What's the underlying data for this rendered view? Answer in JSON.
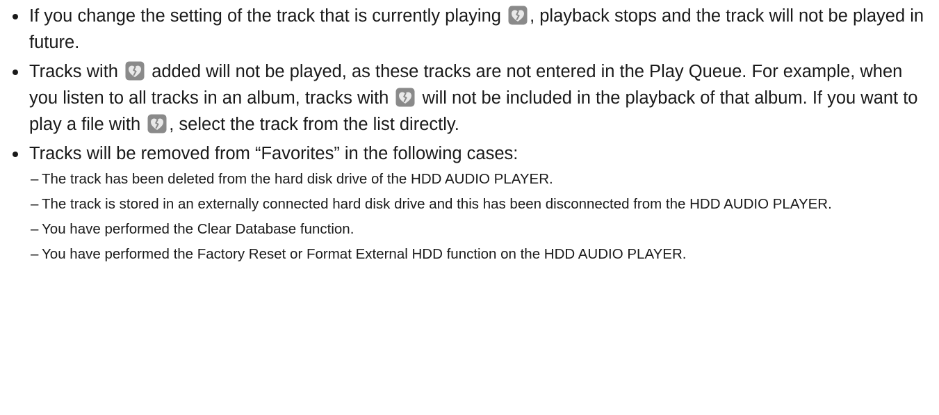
{
  "icons": {
    "broken_heart": "broken-heart-icon",
    "icon_bg": "#8a8a8a",
    "icon_fg": "#e9e9e9"
  },
  "bullets": {
    "b1": {
      "t1": "If you change the setting of the track that is currently playing",
      "t2": ", playback stops and the track will not be played in future."
    },
    "b2": {
      "t1": "Tracks with",
      "t2": "added will not be played, as these tracks are not entered in the Play Queue. For example, when you listen to all tracks in an album, tracks with",
      "t3": "will not be included in the playback of that album. If you want to play a file with",
      "t4": ", select the track from the list directly."
    },
    "b3": {
      "text": "Tracks will be removed from “Favorites” in the following cases:",
      "cases": [
        "The track has been deleted from the hard disk drive of the HDD AUDIO PLAYER.",
        "The track is stored in an externally connected hard disk drive and this has been disconnected from the HDD AUDIO PLAYER.",
        "You have performed the Clear Database function.",
        "You have performed the Factory Reset or Format External HDD function on the HDD AUDIO PLAYER."
      ]
    }
  }
}
